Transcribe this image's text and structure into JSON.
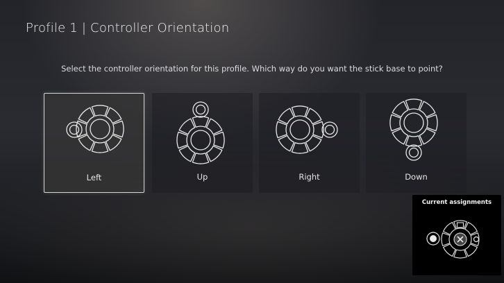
{
  "header": {
    "title": "Profile 1 | Controller Orientation"
  },
  "prompt": "Select the controller orientation for this profile. Which way do you want the stick base to point?",
  "options": [
    {
      "label": "Left",
      "selected": true
    },
    {
      "label": "Up",
      "selected": false
    },
    {
      "label": "Right",
      "selected": false
    },
    {
      "label": "Down",
      "selected": false
    }
  ],
  "assignments": {
    "title": "Current assignments"
  },
  "colors": {
    "background": "#23242a",
    "selected_border": "#d9d6d0",
    "outline": "#e8e8e8"
  }
}
